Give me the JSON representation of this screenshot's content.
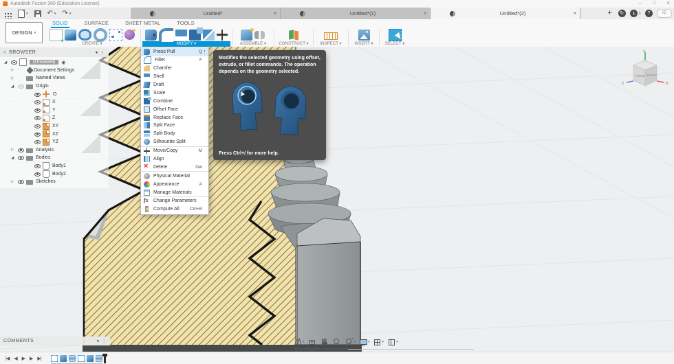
{
  "app": {
    "title": "Autodesk Fusion 360 (Education License)"
  },
  "window": {
    "minimize": "–",
    "maximize": "□",
    "close": "×"
  },
  "ui": {
    "caret": "▾",
    "plus": "+",
    "dot": "●",
    "more": "⋮",
    "chevrons": "«"
  },
  "quickbar": {
    "undo": "↶",
    "redo": "↷",
    "sync": "↻",
    "notification_count": "1",
    "help": "?",
    "avatar": "ID"
  },
  "tabs": [
    {
      "label": "Untitled*",
      "close": "×",
      "cls": ""
    },
    {
      "label": "Untitled*(1)",
      "close": "×",
      "cls": ""
    },
    {
      "label": "Untitled*(2)",
      "close": "×",
      "cls": "tab-active"
    }
  ],
  "ribbon": {
    "design": "DESIGN",
    "envs": [
      {
        "label": "SOLID",
        "cls": "env-active"
      },
      {
        "label": "SURFACE",
        "cls": ""
      },
      {
        "label": "SHEET METAL",
        "cls": ""
      },
      {
        "label": "TOOLS",
        "cls": ""
      }
    ],
    "groups": {
      "create": "CREATE ▾",
      "modify": "MODIFY ▾",
      "assemble": "ASSEMBLE ▾",
      "construct": "CONSTRUCT ▾",
      "inspect": "INSPECT ▾",
      "insert": "INSERT ▾",
      "select": "SELECT ▾"
    }
  },
  "modify_menu": {
    "items": [
      {
        "label": "Press Pull",
        "shortcut": "Q",
        "icon": "ic-presspull",
        "cls": "row-sel",
        "more": "⋮"
      },
      {
        "label": "Fillet",
        "shortcut": "F",
        "icon": "ic-fillet"
      },
      {
        "label": "Chamfer",
        "icon": "ic-chamfer"
      },
      {
        "label": "Shell",
        "icon": "ic-shell"
      },
      {
        "label": "Draft",
        "icon": "ic-draft"
      },
      {
        "label": "Scale",
        "icon": "ic-scale"
      },
      {
        "label": "Combine",
        "icon": "ic-combine"
      },
      {
        "label": "Offset Face",
        "icon": "ic-offsetface"
      },
      {
        "label": "Replace Face",
        "icon": "ic-replaceface"
      },
      {
        "label": "Split Face",
        "icon": "ic-splitface"
      },
      {
        "label": "Split Body",
        "icon": "ic-splitbody"
      },
      {
        "label": "Silhouette Split",
        "icon": "ic-silhouette",
        "cls": "row-sepafter"
      },
      {
        "label": "Move/Copy",
        "shortcut": "M",
        "icon": "ic-move"
      },
      {
        "label": "Align",
        "icon": "ic-align"
      },
      {
        "label": "Delete",
        "shortcut": "Del",
        "icon": "ic-delete",
        "cls": "row-sepafter"
      },
      {
        "label": "Physical Material",
        "icon": "ic-physmat"
      },
      {
        "label": "Appearance",
        "shortcut": "A",
        "icon": "ic-appearance"
      },
      {
        "label": "Manage Materials",
        "icon": "ic-manage",
        "cls": "row-sepafter"
      },
      {
        "label": "Change Parameters",
        "icon": "ic-fx"
      },
      {
        "label": "Compute All",
        "shortcut": "Ctrl+B",
        "icon": "ic-compute"
      }
    ]
  },
  "tooltip": {
    "body": "Modifies the selected geometry using offset, extrude, or fillet commands. The operation depends on the geometry selected.",
    "footer": "Press Ctrl+/ for more help."
  },
  "browser": {
    "title": "BROWSER",
    "items": [
      {
        "exp": "◢",
        "icon": "t-doc",
        "label": "(Unsaved)",
        "cls": "lvl0 row-doc",
        "eye": "t-eye",
        "suffix": "◉"
      },
      {
        "exp": "▷",
        "icon": "t-gear",
        "label": "Document Settings",
        "cls": "lvl1"
      },
      {
        "exp": "▷",
        "icon": "t-folder",
        "label": "Named Views",
        "cls": "lvl1"
      },
      {
        "exp": "◢",
        "icon": "t-folder",
        "label": "Origin",
        "cls": "lvl1",
        "eye": "t-eye eye-dim"
      },
      {
        "icon": "t-origin",
        "label": "O",
        "cls": "lvl2",
        "eye": "t-eye"
      },
      {
        "icon": "t-plane",
        "label": "X",
        "cls": "lvl2",
        "eye": "t-eye"
      },
      {
        "icon": "t-plane",
        "label": "Y",
        "cls": "lvl2",
        "eye": "t-eye"
      },
      {
        "icon": "t-plane",
        "label": "Z",
        "cls": "lvl2",
        "eye": "t-eye"
      },
      {
        "icon": "t-planef",
        "label": "XY",
        "cls": "lvl2",
        "eye": "t-eye"
      },
      {
        "icon": "t-planef",
        "label": "XZ",
        "cls": "lvl2",
        "eye": "t-eye"
      },
      {
        "icon": "t-planef",
        "label": "YZ",
        "cls": "lvl2",
        "eye": "t-eye"
      },
      {
        "exp": "▷",
        "icon": "t-folder",
        "label": "Analysis",
        "cls": "lvl1",
        "eye": "t-eye"
      },
      {
        "exp": "◢",
        "icon": "t-folder",
        "label": "Bodies",
        "cls": "lvl1",
        "eye": "t-eye"
      },
      {
        "icon": "t-body",
        "label": "Body1",
        "cls": "lvl2",
        "eye": "t-eye"
      },
      {
        "icon": "t-body",
        "label": "Body2",
        "cls": "lvl2",
        "eye": "t-eye"
      },
      {
        "exp": "▷",
        "icon": "t-folder",
        "label": "Sketches",
        "cls": "lvl1",
        "eye": "t-eye"
      }
    ]
  },
  "comments": {
    "title": "COMMENTS"
  },
  "viewcube": {
    "front": "FRONT",
    "right": "RIGHT",
    "x": "X",
    "y": "Y",
    "z": "Z"
  },
  "navbar": {
    "icons": [
      {
        "icon": "nv-orbit",
        "caret": "▾"
      },
      {
        "icon": "nv-lookat",
        "caret": ""
      },
      {
        "icon": "nv-pan",
        "caret": ""
      },
      {
        "icon": "nv-zoom",
        "caret": ""
      },
      {
        "icon": "nv-fit",
        "caret": "▾"
      },
      {
        "icon": "nv-display",
        "caret": "▾"
      },
      {
        "icon": "nv-grid",
        "caret": "▾"
      },
      {
        "icon": "nv-views",
        "caret": "▾"
      }
    ]
  },
  "timeline": {
    "buttons": [
      {
        "g": "|◀"
      },
      {
        "g": "◀"
      },
      {
        "g": "▶"
      },
      {
        "g": "▶"
      },
      {
        "g": "▶|"
      }
    ],
    "features": [
      {
        "icon": "tl-sketch"
      },
      {
        "icon": "tl-extrude"
      },
      {
        "icon": "tl-coil"
      },
      {
        "icon": "tl-sketch"
      },
      {
        "icon": "tl-extrude"
      },
      {
        "icon": "tl-coil"
      }
    ]
  },
  "colors": {
    "accent": "#0696d7",
    "hatch_fill": "#f2e3ad",
    "hatch_line": "#867545"
  }
}
